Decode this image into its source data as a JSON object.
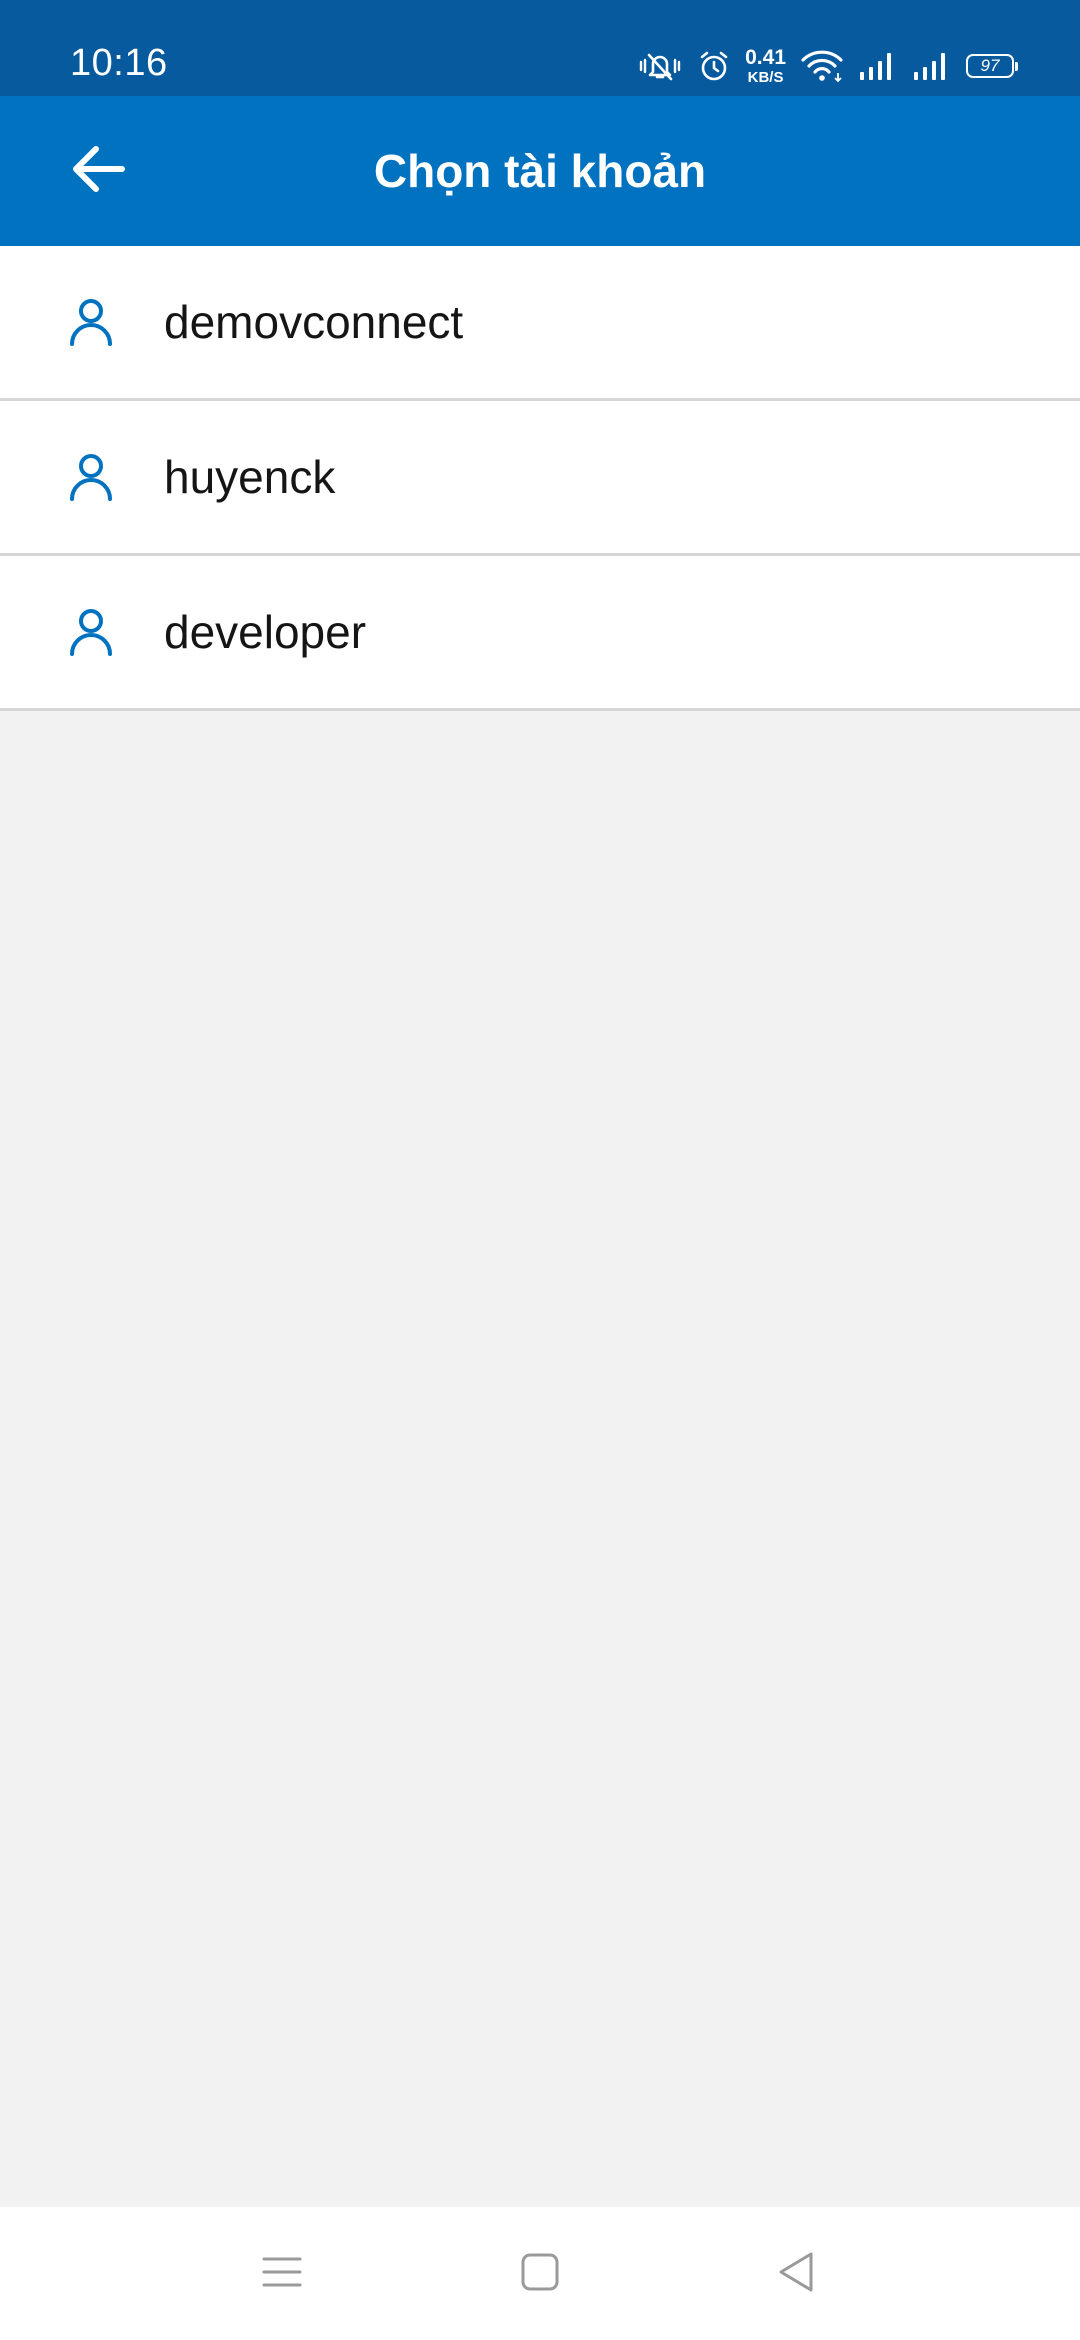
{
  "status_bar": {
    "time": "10:16",
    "net_speed_value": "0.41",
    "net_speed_unit": "KB/S",
    "battery": "97",
    "icons": [
      "vibrate-mute-icon",
      "alarm-icon",
      "wifi-icon",
      "signal-icon",
      "signal-icon",
      "battery-icon"
    ]
  },
  "header": {
    "title": "Chọn tài khoản",
    "back_icon": "arrow-left-icon"
  },
  "accounts": [
    {
      "name": "demovconnect",
      "icon": "user-icon"
    },
    {
      "name": "huyenck",
      "icon": "user-icon"
    },
    {
      "name": "developer",
      "icon": "user-icon"
    }
  ],
  "nav_bar": {
    "icons": [
      "menu-icon",
      "home-icon",
      "back-icon"
    ]
  },
  "colors": {
    "status_bar": "#085a9e",
    "app_bar": "#0072bf",
    "accent": "#0072bf",
    "background": "#f2f2f2"
  }
}
